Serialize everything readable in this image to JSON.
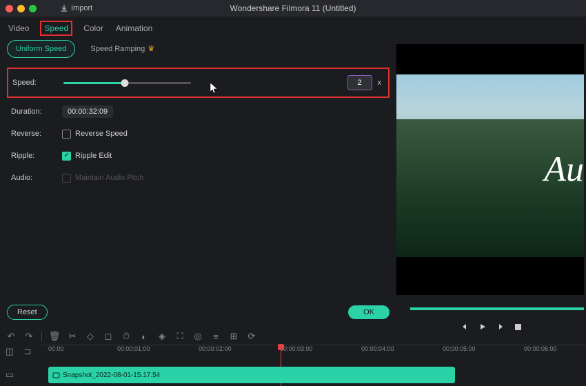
{
  "app": {
    "title": "Wondershare Filmora 11 (Untitled)",
    "import_label": "Import"
  },
  "tabs": {
    "video": "Video",
    "speed": "Speed",
    "color": "Color",
    "animation": "Animation"
  },
  "subtabs": {
    "uniform": "Uniform Speed",
    "ramping": "Speed Ramping"
  },
  "labels": {
    "speed": "Speed:",
    "duration": "Duration:",
    "reverse": "Reverse:",
    "ripple": "Ripple:",
    "audio": "Audio:"
  },
  "values": {
    "speed_value": "2",
    "speed_suffix": "x",
    "duration_value": "00:00:32:09",
    "reverse_label": "Reverse Speed",
    "ripple_label": "Ripple Edit",
    "audio_label": "Maintain Audio Pitch"
  },
  "buttons": {
    "reset": "Reset",
    "ok": "OK"
  },
  "preview": {
    "overlay_text": "Au"
  },
  "timeline": {
    "ticks": [
      "00:00",
      "00:00:01:00",
      "00:00:02:00",
      "00:00:03:00",
      "00:00:04:00",
      "00:00:05:00",
      "00:00:06:00"
    ],
    "playhead_time": "00:00:03:00",
    "clip_name": "Snapshot_2022-08-01-15.17.54"
  },
  "colors": {
    "accent": "#2bd1a7",
    "highlight": "#e03030"
  }
}
